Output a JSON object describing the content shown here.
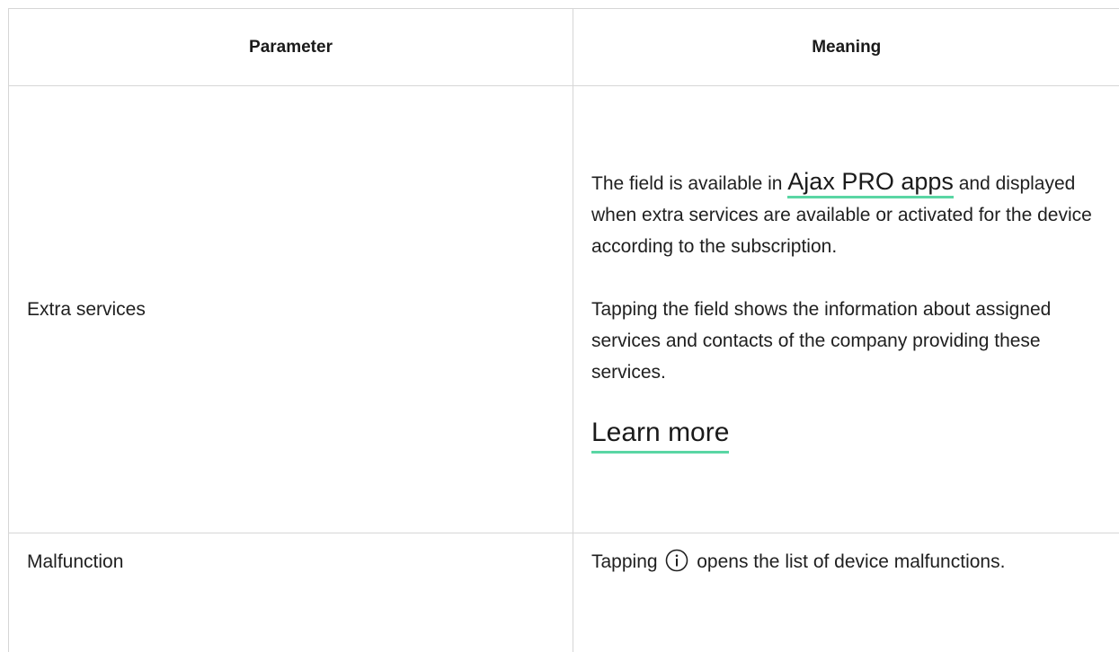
{
  "table": {
    "headers": {
      "parameter": "Parameter",
      "meaning": "Meaning"
    },
    "rows": [
      {
        "parameter": "Extra services",
        "meaning": {
          "p1_before": "The field is available in ",
          "p1_link": "Ajax PRO apps",
          "p1_after": " and displayed when extra services are available or activated for the device according to the subscription.",
          "p2": "Tapping the field shows the information about assigned services and contacts of the company providing these services.",
          "link": "Learn more"
        }
      },
      {
        "parameter": "Malfunction",
        "meaning": {
          "before_icon": "Tapping ",
          "icon": "info-circle-icon",
          "after_icon": " opens the list of device malfunctions."
        }
      }
    ]
  },
  "colors": {
    "link_underline": "#5ad6a4",
    "border": "#d6d6d6",
    "text": "#1f1f1f"
  }
}
